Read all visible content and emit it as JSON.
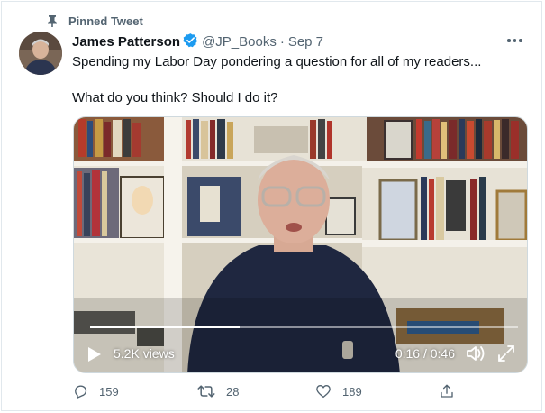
{
  "pinned_label": "Pinned Tweet",
  "author": {
    "name": "James Patterson",
    "handle": "@JP_Books",
    "separator": "·",
    "date": "Sep 7",
    "verified": true
  },
  "tweet": {
    "line1": "Spending my Labor Day pondering a question for all of my readers...",
    "line2": "What do you think? Should I do it?"
  },
  "video": {
    "views": "5.2K views",
    "time": "0:16 / 0:46",
    "progress_fraction": 0.35
  },
  "actions": {
    "replies": "159",
    "retweets": "28",
    "likes": "189"
  },
  "colors": {
    "accent": "#1d9bf0",
    "secondary_text": "#536471",
    "primary_text": "#0f1419"
  },
  "icons": [
    "pin-icon",
    "verified-badge-icon",
    "more-icon",
    "play-icon",
    "volume-icon",
    "fullscreen-icon",
    "reply-icon",
    "retweet-icon",
    "like-icon",
    "share-icon"
  ]
}
